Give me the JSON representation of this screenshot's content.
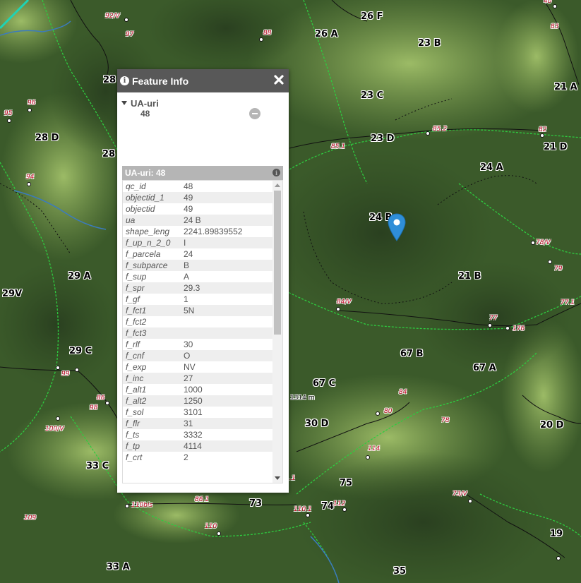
{
  "map": {
    "colors": {
      "forest_dark": "#2f4a22",
      "meadow": "#8fae5a",
      "boundary_green": "#2ecc40",
      "road_red": "#c8102e"
    },
    "stand_labels": [
      "26 F",
      "26 A",
      "23 B",
      "23 C",
      "21 A",
      "28",
      "28 D",
      "28",
      "23 D",
      "21 D",
      "24 A",
      "24 B",
      "29 A",
      "29V",
      "21 B",
      "29 C",
      "67 B",
      "67 A",
      "67 C",
      "30 D",
      "33 C",
      "20 D",
      "75",
      "73",
      "74",
      "19",
      "33 A",
      "35"
    ],
    "point_labels": [
      "92/V",
      "97",
      "88",
      "40",
      "83",
      "95",
      "96",
      "85.2",
      "82",
      "85.1",
      "94",
      "78/V",
      "79",
      "84/V",
      "77",
      "176",
      "77.1",
      "99",
      "86",
      "98",
      "84",
      "80",
      "100/V",
      "78",
      "114",
      "86.1",
      "110bis",
      "73/V",
      "109",
      "110.1",
      "112",
      "110",
      ".1"
    ],
    "scale_text": "1314 m"
  },
  "popup": {
    "title": "Feature Info",
    "layer_name": "UA-uri",
    "feature_id": "48",
    "attr_title": "UA-uri: 48",
    "attributes": [
      {
        "key": "qc_id",
        "value": "48"
      },
      {
        "key": "objectid_1",
        "value": "49"
      },
      {
        "key": "objectid",
        "value": "49"
      },
      {
        "key": "ua",
        "value": "24 B"
      },
      {
        "key": "shape_leng",
        "value": "2241.89839552"
      },
      {
        "key": "f_up_n_2_0",
        "value": "I"
      },
      {
        "key": "f_parcela",
        "value": "24"
      },
      {
        "key": "f_subparce",
        "value": "B"
      },
      {
        "key": "f_sup",
        "value": "A"
      },
      {
        "key": "f_spr",
        "value": "29.3"
      },
      {
        "key": "f_gf",
        "value": "1"
      },
      {
        "key": "f_fct1",
        "value": "5N"
      },
      {
        "key": "f_fct2",
        "value": ""
      },
      {
        "key": "f_fct3",
        "value": ""
      },
      {
        "key": "f_rlf",
        "value": "30"
      },
      {
        "key": "f_cnf",
        "value": "O"
      },
      {
        "key": "f_exp",
        "value": "NV"
      },
      {
        "key": "f_inc",
        "value": "27"
      },
      {
        "key": "f_alt1",
        "value": "1000"
      },
      {
        "key": "f_alt2",
        "value": "1250"
      },
      {
        "key": "f_sol",
        "value": "3101"
      },
      {
        "key": "f_flr",
        "value": "31"
      },
      {
        "key": "f_ts",
        "value": "3332"
      },
      {
        "key": "f_tp",
        "value": "4114"
      },
      {
        "key": "f_crt",
        "value": "2"
      }
    ]
  }
}
